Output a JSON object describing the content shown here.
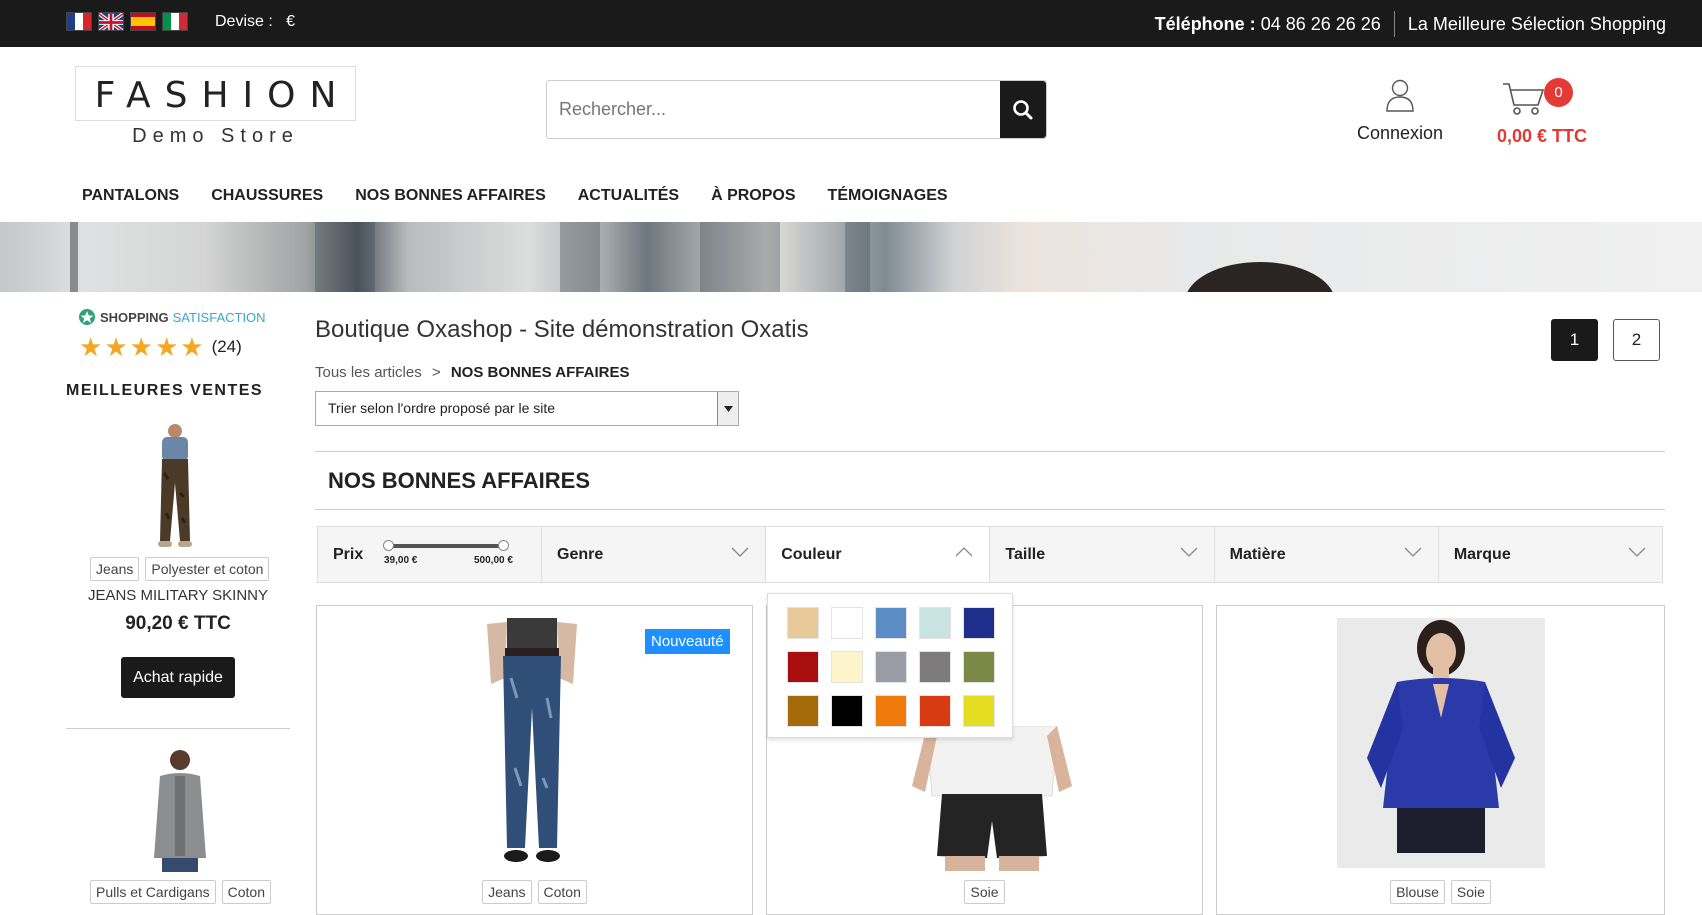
{
  "topbar": {
    "devise_label": "Devise :",
    "devise_value": "€",
    "phone_label": "Téléphone :",
    "phone_number": "04 86 26 26 26",
    "tagline": "La Meilleure Sélection Shopping",
    "flags": [
      "fr",
      "uk",
      "es",
      "it"
    ]
  },
  "header": {
    "logo_title": "FASHION",
    "logo_sub": "Demo Store",
    "search_placeholder": "Rechercher...",
    "account_label": "Connexion",
    "cart_count": "0",
    "cart_total": "0,00 € TTC"
  },
  "nav": [
    "PANTALONS",
    "CHAUSSURES",
    "NOS BONNES AFFAIRES",
    "ACTUALITÉS",
    "À PROPOS",
    "TÉMOIGNAGES"
  ],
  "sidebar": {
    "badge_part1": "SHOPPING",
    "badge_part2": "SATISFACTION",
    "rating_stars": 5,
    "rating_count": "(24)",
    "best_title": "MEILLEURES VENTES",
    "product1": {
      "tags": [
        "Jeans",
        "Polyester et coton"
      ],
      "name": "JEANS MILITARY SKINNY",
      "price": "90,20 € TTC",
      "button": "Achat rapide"
    },
    "product2": {
      "tags": [
        "Pulls et Cardigans",
        "Coton"
      ]
    }
  },
  "main": {
    "title": "Boutique Oxashop - Site démonstration Oxatis",
    "breadcrumb_root": "Tous les articles",
    "breadcrumb_sep": ">",
    "breadcrumb_current": "NOS BONNES AFFAIRES",
    "sort_value": "Trier selon l'ordre proposé par le site",
    "pages": [
      "1",
      "2"
    ],
    "current_page": "1",
    "section_title": "NOS BONNES AFFAIRES"
  },
  "filters": {
    "prix_label": "Prix",
    "prix_min": "39,00 €",
    "prix_max": "500,00 €",
    "labels": [
      "Genre",
      "Couleur",
      "Taille",
      "Matière",
      "Marque"
    ],
    "open_filter": "Couleur"
  },
  "colors": [
    "#e8c99a",
    "#ffffff",
    "#5b8cc4",
    "#c8e3e0",
    "#1e2f8c",
    "#a80e0e",
    "#fdf4cc",
    "#9a9ca6",
    "#7c7a7a",
    "#7a8946",
    "#a56a0a",
    "#000000",
    "#f07a0c",
    "#d83a12",
    "#e4dd22"
  ],
  "products": [
    {
      "badge": "Nouveauté",
      "tags": [
        "Jeans",
        "Coton"
      ]
    },
    {
      "tags": [
        "Soie"
      ]
    },
    {
      "tags": [
        "Blouse",
        "Soie"
      ]
    }
  ]
}
